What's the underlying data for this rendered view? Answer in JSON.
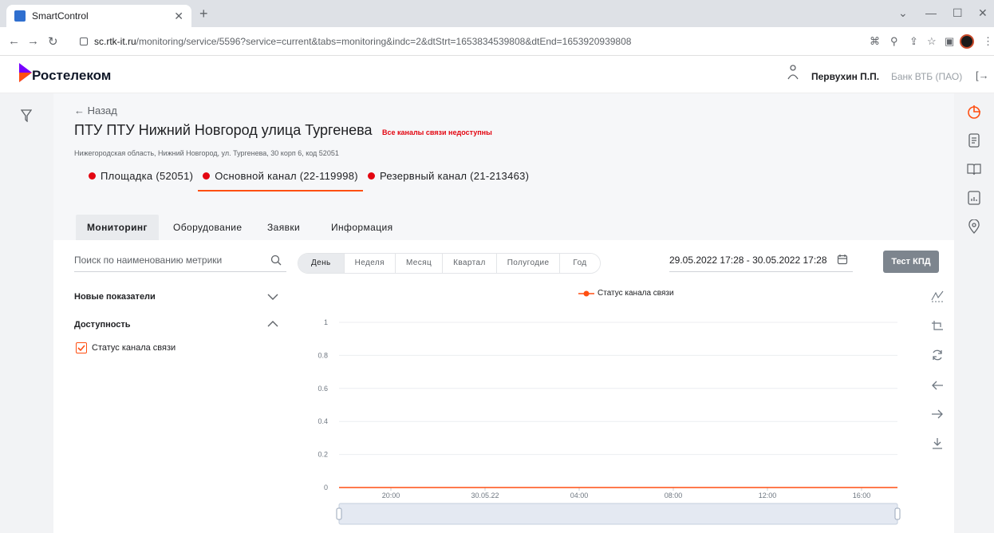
{
  "browser": {
    "tab_title": "SmartControl",
    "url_host": "sc.rtk-it.ru",
    "url_path": "/monitoring/service/5596?service=current&tabs=monitoring&indc=2&dtStrt=1653834539808&dtEnd=1653920939808"
  },
  "header": {
    "logo_text": "Ростелеком",
    "user_name": "Первухин П.П.",
    "org_name": "Банк ВТБ (ПАО)"
  },
  "page": {
    "back_label": "Назад",
    "title": "ПТУ ПТУ Нижний Новгород улица Тургенева",
    "status": "Все каналы связи недоступны",
    "address": "Нижегородская область, Нижний Новгород, ул. Тургенева, 30 корп 6, код 52051",
    "channels": [
      {
        "label": "Площадка (52051)"
      },
      {
        "label": "Основной канал (22-119998)"
      },
      {
        "label": "Резервный канал (21-213463)"
      }
    ]
  },
  "tabs": [
    "Мониторинг",
    "Оборудование",
    "Заявки",
    "Информация"
  ],
  "toolbar": {
    "search_placeholder": "Поиск по наименованию метрики",
    "periods": [
      "День",
      "Неделя",
      "Месяц",
      "Квартал",
      "Полугодие",
      "Год"
    ],
    "date_range": "29.05.2022 17:28 - 30.05.2022 17:28",
    "test_button": "Тест КПД"
  },
  "metrics": {
    "group_new": "Новые показатели",
    "group_availability": "Доступность",
    "item_status": "Статус канала связи"
  },
  "colors": {
    "accent": "#ff4f12",
    "status_red": "#e30611",
    "logo_violet": "#7700ff"
  },
  "chart_data": {
    "type": "line",
    "x": [
      "20:00",
      "30.05.22",
      "04:00",
      "08:00",
      "12:00",
      "16:00"
    ],
    "series": [
      {
        "name": "Статус канала связи",
        "values": [
          0,
          0,
          0,
          0,
          0,
          0
        ]
      }
    ],
    "ylim": [
      0,
      1
    ],
    "yticks": [
      "0",
      "0.2",
      "0.4",
      "0.6",
      "0.8",
      "1"
    ],
    "legend": "top-center",
    "grid": true
  }
}
